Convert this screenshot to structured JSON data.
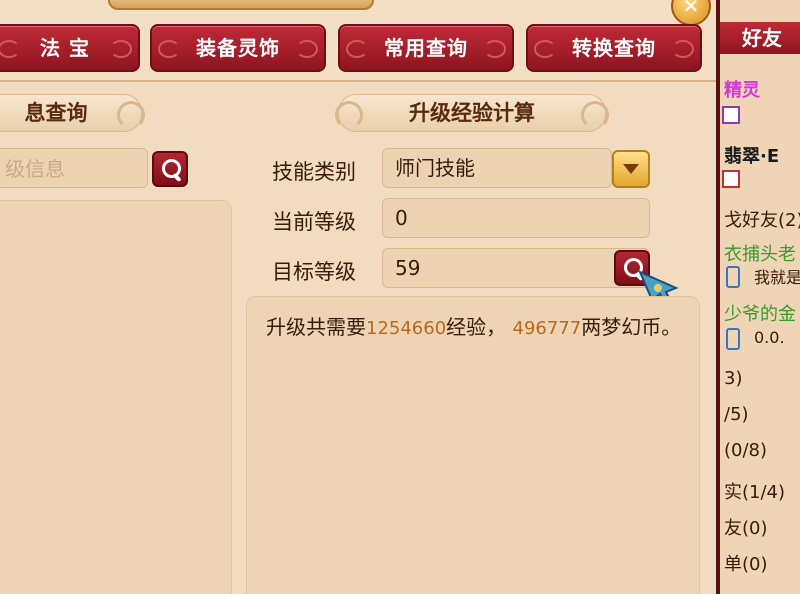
{
  "tabs": [
    {
      "label": "法 宝"
    },
    {
      "label": "装备灵饰"
    },
    {
      "label": "常用查询"
    },
    {
      "label": "转换查询"
    }
  ],
  "left_section": {
    "title": "息查询",
    "search_placeholder": "级信息"
  },
  "calc": {
    "title": "升级经验计算",
    "skill_type_label": "技能类别",
    "skill_type_value": "师门技能",
    "current_level_label": "当前等级",
    "current_level_value": "0",
    "target_level_label": "目标等级",
    "target_level_value": "59",
    "result": {
      "prefix": "升级共需要",
      "exp": "1254660",
      "exp_unit": "经验，",
      "money": "496777",
      "money_unit": "两梦幻币。"
    }
  },
  "friends": {
    "header": "好友",
    "lines": [
      {
        "text": "精灵",
        "color": "#d23ad6"
      },
      {
        "text": "翡翠·E",
        "color": "#1a1a1a"
      },
      {
        "text": "戈好友(2)",
        "color": "#3b1a08"
      },
      {
        "text": "衣捕头老",
        "color": "#3a9a2a"
      },
      {
        "text": "我就是",
        "color": "#3b1a08"
      },
      {
        "text": "少爷的金",
        "color": "#3a9a2a"
      },
      {
        "text": "0.0.",
        "color": "#3b1a08"
      },
      {
        "text": "3)",
        "color": "#3b1a08"
      },
      {
        "text": "/5)",
        "color": "#3b1a08"
      },
      {
        "text": "(0/8)",
        "color": "#3b1a08"
      },
      {
        "text": "实(1/4)",
        "color": "#3b1a08"
      },
      {
        "text": "友(0)",
        "color": "#3b1a08"
      },
      {
        "text": "单(0)",
        "color": "#3b1a08"
      }
    ]
  }
}
